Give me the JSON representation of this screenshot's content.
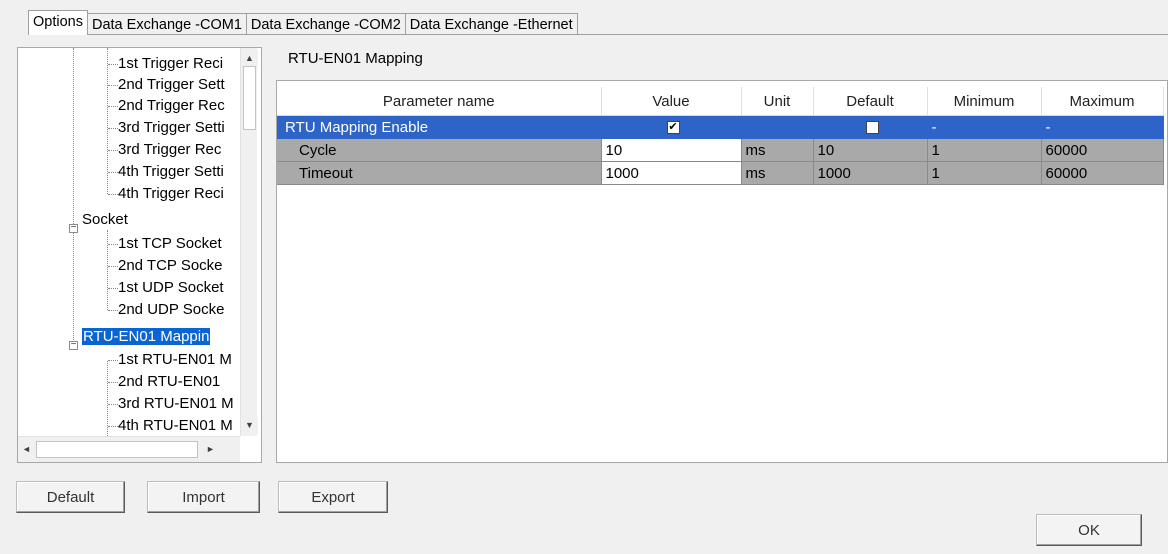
{
  "tabs": [
    "Options",
    "Data Exchange -COM1",
    "Data Exchange -COM2",
    "Data Exchange -Ethernet"
  ],
  "active_tab": "Options",
  "tree": {
    "items": [
      "1st Trigger Reci",
      "2nd Trigger Sett",
      "2nd Trigger Rec",
      "3rd Trigger Setti",
      "3rd Trigger Rec",
      "4th Trigger Setti",
      "4th Trigger Reci",
      "Socket",
      "1st TCP Socket",
      "2nd TCP Socke",
      "1st UDP Socket",
      "2nd UDP Socke",
      "RTU-EN01 Mappin",
      "1st RTU-EN01 M",
      "2nd RTU-EN01",
      "3rd RTU-EN01 M",
      "4th RTU-EN01 M"
    ],
    "selected": "RTU-EN01 Mappin"
  },
  "section_title": "RTU-EN01 Mapping",
  "grid": {
    "columns": [
      "Parameter name",
      "Value",
      "Unit",
      "Default",
      "Minimum",
      "Maximum"
    ],
    "rows": [
      {
        "name": "RTU Mapping Enable",
        "value_checked": true,
        "unit": "",
        "default_checked": false,
        "minimum": "-",
        "maximum": "-"
      },
      {
        "name": "Cycle",
        "value": "10",
        "unit": "ms",
        "default": "10",
        "minimum": "1",
        "maximum": "60000"
      },
      {
        "name": "Timeout",
        "value": "1000",
        "unit": "ms",
        "default": "1000",
        "minimum": "1",
        "maximum": "60000"
      }
    ]
  },
  "buttons": {
    "default": "Default",
    "import": "Import",
    "export": "Export",
    "ok": "OK"
  },
  "glyphs": {
    "check": "✔",
    "scroll_up": "▲",
    "scroll_down": "▼",
    "scroll_left": "◄",
    "scroll_right": "►",
    "collapse": "−"
  },
  "colors": {
    "selection": "#0a64d2",
    "grid_selected_row": "#2e64c8",
    "disabled_cell": "#a9a9a9"
  }
}
